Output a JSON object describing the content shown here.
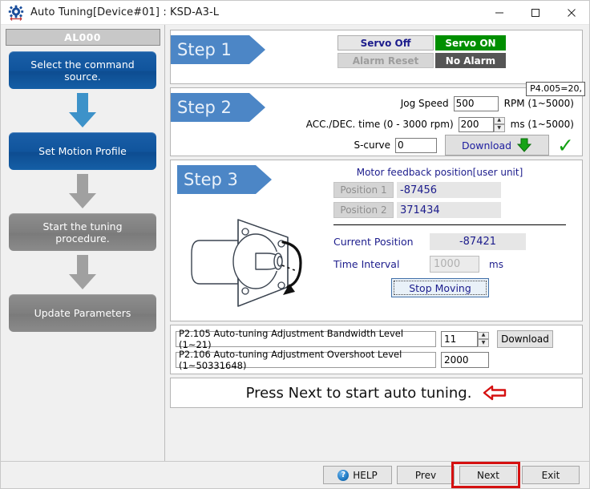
{
  "window": {
    "title": "Auto Tuning[Device#01] : KSD-A3-L",
    "icon": "gear-icon",
    "minimize": "–",
    "maximize": "□",
    "close": "✕"
  },
  "sidebar": {
    "header": "AL000",
    "items": [
      {
        "label": "Select the command source.",
        "state": "active"
      },
      {
        "label": "Set Motion Profile",
        "state": "active"
      },
      {
        "label": "Start the tuning procedure.",
        "state": "inactive"
      },
      {
        "label": "Update Parameters",
        "state": "inactive"
      }
    ]
  },
  "step1": {
    "tag": "Step 1",
    "servo_off_button": "Servo Off",
    "servo_status": "Servo ON",
    "alarm_reset_button": "Alarm Reset",
    "alarm_status": "No Alarm",
    "tooltip": "P4.005=20,"
  },
  "step2": {
    "tag": "Step 2",
    "jog_speed_label": "Jog Speed",
    "jog_speed_value": "500",
    "jog_speed_unit": "RPM (1~5000)",
    "acc_dec_label": "ACC./DEC. time (0 - 3000 rpm)",
    "acc_dec_value": "200",
    "acc_dec_unit": "ms (1~5000)",
    "scurve_label": "S-curve",
    "scurve_value": "0",
    "download_label": "Download",
    "download_icon": "download-arrow-icon",
    "status_icon": "green-check-icon"
  },
  "step3": {
    "tag": "Step 3",
    "illustration": "servo-motor-icon",
    "feedback_title": "Motor feedback position[user unit]",
    "position1_label": "Position 1",
    "position1_value": "-87456",
    "position2_label": "Position 2",
    "position2_value": "371434",
    "current_position_label": "Current Position",
    "current_position_value": "-87421",
    "time_interval_label": "Time Interval",
    "time_interval_value": "1000",
    "time_interval_unit": "ms",
    "stop_button": "Stop Moving"
  },
  "params": {
    "rows": [
      {
        "name": "P2.105 Auto-tuning Adjustment Bandwidth Level (1~21)",
        "value": "11",
        "has_spinner": true
      },
      {
        "name": "P2.106 Auto-tuning Adjustment Overshoot Level (1~50331648)",
        "value": "2000",
        "has_spinner": false
      }
    ],
    "download_label": "Download"
  },
  "message": {
    "text": "Press Next to start auto tuning.",
    "arrow_icon": "red-left-arrow-icon"
  },
  "footer": {
    "help_label": "HELP",
    "help_icon": "question-mark-icon",
    "prev_label": "Prev",
    "next_label": "Next",
    "exit_label": "Exit",
    "highlighted_button": "Next"
  },
  "colors": {
    "accent_blue": "#0d4c90",
    "step_tag_blue": "#4c86c6",
    "status_green": "#008f00",
    "status_dark": "#555555",
    "highlight_red": "#d51010",
    "navy_text": "#1c1c8c"
  }
}
